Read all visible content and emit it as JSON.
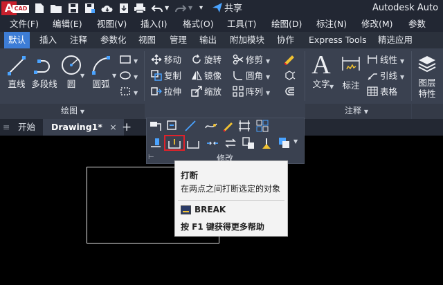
{
  "app": {
    "logo_text": "CAD",
    "title": "Autodesk Auto",
    "share_label": "共享"
  },
  "menu": [
    "文件(F)",
    "编辑(E)",
    "视图(V)",
    "插入(I)",
    "格式(O)",
    "工具(T)",
    "绘图(D)",
    "标注(N)",
    "修改(M)",
    "参数"
  ],
  "ribbon_tabs": [
    "默认",
    "插入",
    "注释",
    "参数化",
    "视图",
    "管理",
    "输出",
    "附加模块",
    "协作",
    "Express Tools",
    "精选应用"
  ],
  "ribbon": {
    "draw": {
      "line": "直线",
      "polyline": "多段线",
      "circle": "圆",
      "arc": "圆弧",
      "title": "绘图"
    },
    "modify": {
      "move": "移动",
      "rotate": "旋转",
      "trim": "修剪",
      "copy": "复制",
      "mirror": "镜像",
      "fillet": "圆角",
      "stretch": "拉伸",
      "scale": "缩放",
      "array": "阵列",
      "title": "修改"
    },
    "annotation": {
      "text": "文字",
      "dimension": "标注",
      "linear": "线性",
      "leader": "引线",
      "table": "表格",
      "title": "注释"
    },
    "layers": {
      "layer_props_line1": "图层",
      "layer_props_line2": "特性"
    }
  },
  "doc_tabs": {
    "start": "开始",
    "drawing": "Drawing1*",
    "close": "×",
    "add": "+"
  },
  "tooltip": {
    "title": "打断",
    "description": "在两点之间打断选定的对象",
    "command": "BREAK",
    "help": "按 F1 键获得更多帮助"
  },
  "colors": {
    "accent_tab": "#3d7dd6",
    "highlight_border": "#e0222a",
    "ribbon_bg": "#3a4150"
  }
}
